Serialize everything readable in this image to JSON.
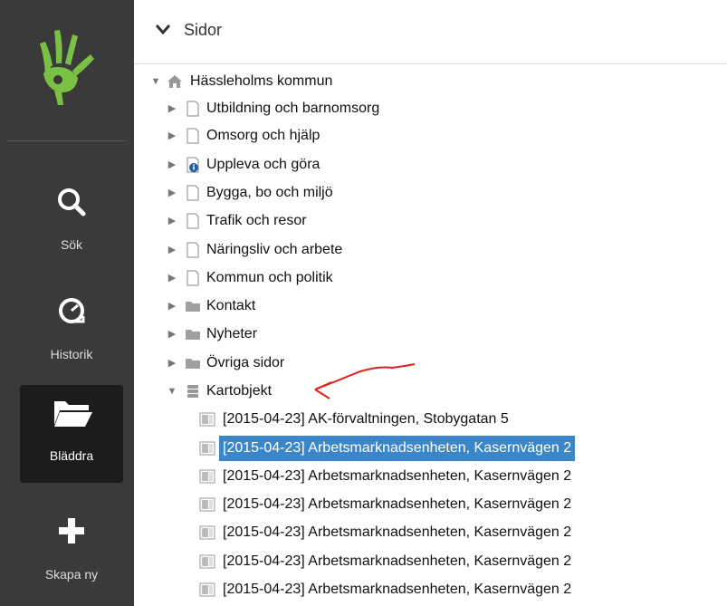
{
  "sidebar": {
    "nav": [
      {
        "label": "Sök",
        "icon": "search-icon"
      },
      {
        "label": "Historik",
        "icon": "history-icon"
      },
      {
        "label": "Bläddra",
        "icon": "folder-open-icon",
        "active": true
      },
      {
        "label": "Skapa ny",
        "icon": "plus-icon"
      }
    ]
  },
  "header": {
    "title": "Sidor"
  },
  "tree": {
    "root": "Hässleholms kommun",
    "children": [
      "Utbildning och barnomsorg",
      "Omsorg och hjälp",
      "Uppleva och göra",
      "Bygga, bo och miljö",
      "Trafik och resor",
      "Näringsliv och arbete",
      "Kommun och politik",
      "Kontakt",
      "Nyheter",
      "Övriga sidor",
      "Kartobjekt"
    ],
    "kartobjekt_items": [
      "[2015-04-23] AK-förvaltningen, Stobygatan 5",
      "[2015-04-23] Arbetsmarknadsenheten, Kasernvägen 2",
      "[2015-04-23] Arbetsmarknadsenheten, Kasernvägen 2",
      "[2015-04-23] Arbetsmarknadsenheten, Kasernvägen 2",
      "[2015-04-23] Arbetsmarknadsenheten, Kasernvägen 2",
      "[2015-04-23] Arbetsmarknadsenheten, Kasernvägen 2",
      "[2015-04-23] Arbetsmarknadsenheten, Kasernvägen 2"
    ]
  },
  "colors": {
    "sidebar": "#3a3a3a",
    "active": "#1c1c1c",
    "logo_green": "#7ac143",
    "selection": "#3a86c8",
    "annotation": "#e0201b"
  }
}
